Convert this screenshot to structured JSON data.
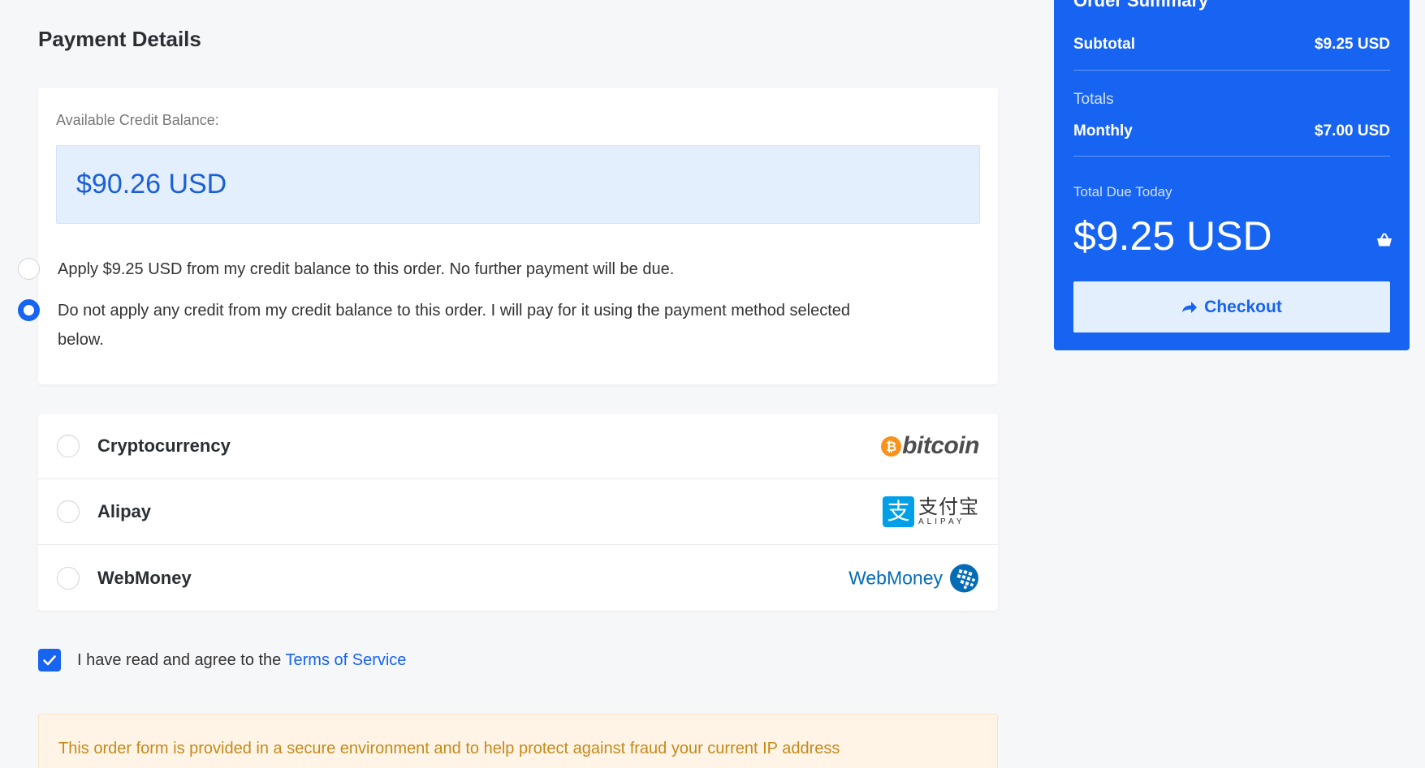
{
  "page_title": "Payment Details",
  "credit": {
    "label": "Available Credit Balance:",
    "amount": "$90.26 USD",
    "options": [
      {
        "label": "Apply $9.25 USD from my credit balance to this order. No further payment will be due.",
        "selected": false
      },
      {
        "label": "Do not apply any credit from my credit balance to this order. I will pay for it using the payment method selected below.",
        "selected": true
      }
    ]
  },
  "payment_methods": [
    {
      "name": "Cryptocurrency",
      "logo": "bitcoin-logo",
      "logo_text": "bitcoin",
      "logo_glyph": "₿"
    },
    {
      "name": "Alipay",
      "logo": "alipay-logo",
      "logo_text": "支付宝",
      "logo_sub": "ALIPAY",
      "logo_glyph": "支"
    },
    {
      "name": "WebMoney",
      "logo": "webmoney-logo",
      "logo_text": "WebMoney"
    }
  ],
  "terms": {
    "checked": true,
    "text": "I have read and agree to the ",
    "link": "Terms of Service"
  },
  "alert": {
    "text": "This order form is provided in a secure environment and to help protect against fraud your current IP address"
  },
  "summary": {
    "title": "Order Summary",
    "subtotal_label": "Subtotal",
    "subtotal_value": "$9.25 USD",
    "totals_label": "Totals",
    "monthly_label": "Monthly",
    "monthly_value": "$7.00 USD",
    "due_label": "Total Due Today",
    "due_value": "$9.25 USD",
    "checkout_label": "Checkout"
  },
  "colors": {
    "accent": "#1763f2",
    "credit_bg": "#e3effd",
    "alert_bg": "#fff4e6",
    "alert_text": "#c48a1a",
    "bitcoin": "#f7931a",
    "alipay": "#00a0e9",
    "webmoney": "#036cb5"
  }
}
